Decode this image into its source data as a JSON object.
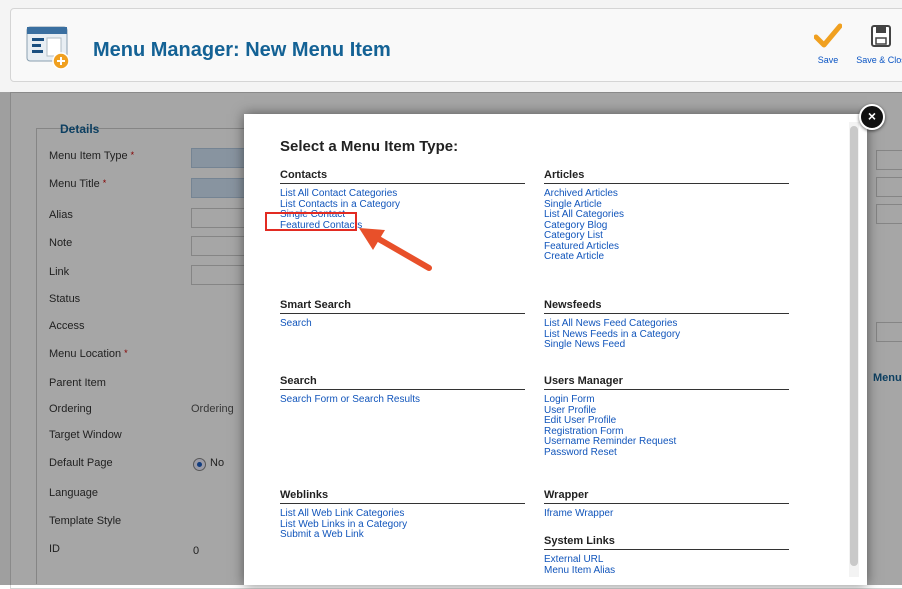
{
  "header": {
    "title": "Menu Manager: New Menu Item",
    "save_label": "Save",
    "save_close_label": "Save & Clos"
  },
  "form": {
    "legend": "Details",
    "labels": {
      "menu_item_type": "Menu Item Type",
      "menu_title": "Menu Title",
      "alias": "Alias",
      "note": "Note",
      "link": "Link",
      "status": "Status",
      "access": "Access",
      "menu_location": "Menu Location",
      "parent_item": "Parent Item",
      "ordering": "Ordering",
      "target_window": "Target Window",
      "default_page": "Default Page",
      "language": "Language",
      "template_style": "Template Style",
      "id": "ID"
    },
    "required_mark": "*",
    "ordering_text": "Ordering",
    "default_page_value": "No",
    "id_value": "0",
    "right_partial_text": "Menu"
  },
  "modal": {
    "title": "Select a Menu Item Type:",
    "close_glyph": "×",
    "groups": {
      "contacts": {
        "name": "Contacts",
        "items": [
          "List All Contact Categories",
          "List Contacts in a Category",
          "Single Contact",
          "Featured Contacts"
        ]
      },
      "smart_search": {
        "name": "Smart Search",
        "items": [
          "Search"
        ]
      },
      "search": {
        "name": "Search",
        "items": [
          "Search Form or Search Results"
        ]
      },
      "weblinks": {
        "name": "Weblinks",
        "items": [
          "List All Web Link Categories",
          "List Web Links in a Category",
          "Submit a Web Link"
        ]
      },
      "articles": {
        "name": "Articles",
        "items": [
          "Archived Articles",
          "Single Article",
          "List All Categories",
          "Category Blog",
          "Category List",
          "Featured Articles",
          "Create Article"
        ]
      },
      "newsfeeds": {
        "name": "Newsfeeds",
        "items": [
          "List All News Feed Categories",
          "List News Feeds in a Category",
          "Single News Feed"
        ]
      },
      "users_manager": {
        "name": "Users Manager",
        "items": [
          "Login Form",
          "User Profile",
          "Edit User Profile",
          "Registration Form",
          "Username Reminder Request",
          "Password Reset"
        ]
      },
      "wrapper": {
        "name": "Wrapper",
        "items": [
          "Iframe Wrapper"
        ]
      },
      "system_links": {
        "name": "System Links",
        "items": [
          "External URL",
          "Menu Item Alias"
        ]
      }
    }
  },
  "colors": {
    "title_blue": "#146295",
    "link_blue": "#1155bb",
    "highlight_red": "#e22b22",
    "arrow_red": "#e8502a",
    "save_orange": "#f0a020"
  },
  "icons": {
    "app": "menu-manager-icon",
    "save": "checkmark-icon",
    "save_close": "floppy-disk-icon",
    "close": "close-icon",
    "annotation": "arrow-icon"
  }
}
